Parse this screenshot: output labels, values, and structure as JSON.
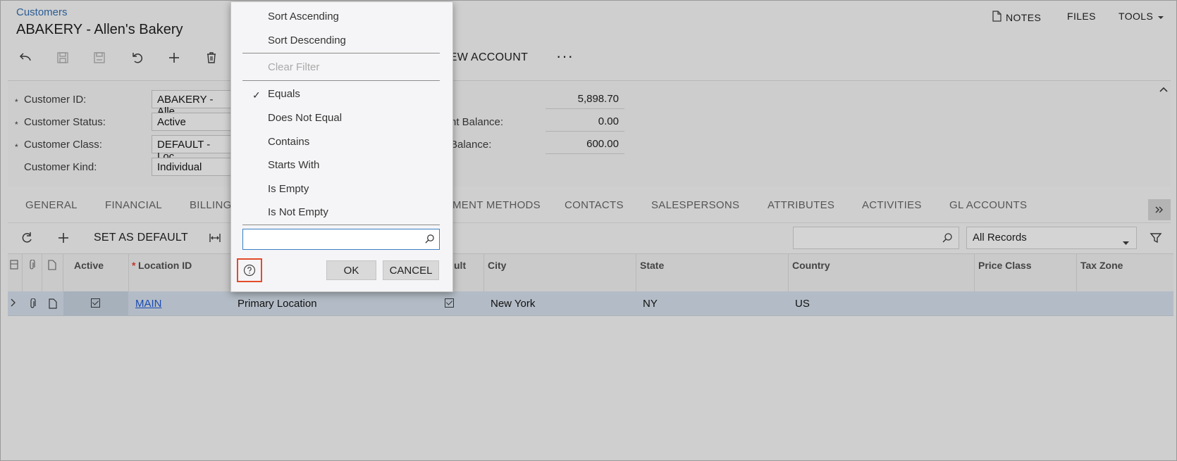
{
  "header": {
    "breadcrumb": "Customers",
    "title": "ABAKERY - Allen's Bakery",
    "nav": {
      "notes": "NOTES",
      "files": "FILES",
      "tools": "TOOLS"
    }
  },
  "toolbar": {
    "view_account": "IEW ACCOUNT",
    "more": "···"
  },
  "form": {
    "customer_id_label": "Customer ID:",
    "customer_id_value": "ABAKERY - Alle",
    "customer_status_label": "Customer Status:",
    "customer_status_value": "Active",
    "customer_class_label": "Customer Class:",
    "customer_class_value": "DEFAULT - Loc",
    "customer_kind_label": "Customer Kind:",
    "customer_kind_value": "Individual",
    "balance_label_2": "nt Balance:",
    "balance_label_3": "Balance:",
    "balance_value_1": "5,898.70",
    "balance_value_2": "0.00",
    "balance_value_3": "600.00",
    "required_mark": "*"
  },
  "tabs": [
    "GENERAL",
    "FINANCIAL",
    "BILLING",
    "MENT METHODS",
    "CONTACTS",
    "SALESPERSONS",
    "ATTRIBUTES",
    "ACTIVITIES",
    "GL ACCOUNTS"
  ],
  "grid_toolbar": {
    "set_as_default": "SET AS DEFAULT",
    "records_filter": "All Records"
  },
  "grid": {
    "columns": {
      "active": "Active",
      "location_id": "Location ID",
      "default_partial": "ult",
      "city": "City",
      "state": "State",
      "country": "Country",
      "price_class": "Price Class",
      "tax_zone": "Tax Zone"
    },
    "rows": [
      {
        "location_id": "MAIN",
        "location_name": "Primary Location",
        "city": "New York",
        "state": "NY",
        "country": "US"
      }
    ]
  },
  "dropdown": {
    "sort_ascending": "Sort Ascending",
    "sort_descending": "Sort Descending",
    "clear_filter": "Clear Filter",
    "equals": "Equals",
    "does_not_equal": "Does Not Equal",
    "contains": "Contains",
    "starts_with": "Starts With",
    "is_empty": "Is Empty",
    "is_not_empty": "Is Not Empty",
    "checkmark": "✓",
    "ok": "OK",
    "cancel": "CANCEL",
    "filter_value": ""
  }
}
